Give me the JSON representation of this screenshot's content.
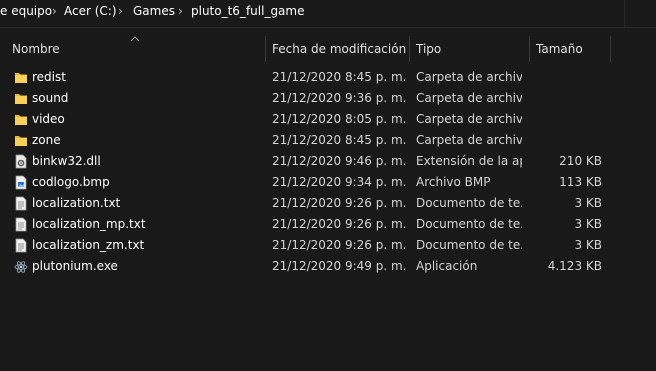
{
  "breadcrumb": {
    "items": [
      "e equipo",
      "Acer (C:)",
      "Games",
      "pluto_t6_full_game"
    ],
    "separator": "›"
  },
  "columns": {
    "name": "Nombre",
    "date": "Fecha de modificación",
    "type": "Tipo",
    "size": "Tamaño"
  },
  "files": [
    {
      "name": "redist",
      "date": "21/12/2020 8:45 p. m.",
      "type": "Carpeta de archivos",
      "size": "",
      "icon": "folder-icon"
    },
    {
      "name": "sound",
      "date": "21/12/2020 9:36 p. m.",
      "type": "Carpeta de archivos",
      "size": "",
      "icon": "folder-icon"
    },
    {
      "name": "video",
      "date": "21/12/2020 8:05 p. m.",
      "type": "Carpeta de archivos",
      "size": "",
      "icon": "folder-icon"
    },
    {
      "name": "zone",
      "date": "21/12/2020 8:45 p. m.",
      "type": "Carpeta de archivos",
      "size": "",
      "icon": "folder-icon"
    },
    {
      "name": "binkw32.dll",
      "date": "21/12/2020 9:46 p. m.",
      "type": "Extensión de la ap...",
      "size": "210 KB",
      "icon": "dll-icon"
    },
    {
      "name": "codlogo.bmp",
      "date": "21/12/2020 9:34 p. m.",
      "type": "Archivo BMP",
      "size": "113 KB",
      "icon": "bmp-icon"
    },
    {
      "name": "localization.txt",
      "date": "21/12/2020 9:26 p. m.",
      "type": "Documento de te...",
      "size": "3 KB",
      "icon": "txt-icon"
    },
    {
      "name": "localization_mp.txt",
      "date": "21/12/2020 9:26 p. m.",
      "type": "Documento de te...",
      "size": "3 KB",
      "icon": "txt-icon"
    },
    {
      "name": "localization_zm.txt",
      "date": "21/12/2020 9:26 p. m.",
      "type": "Documento de te...",
      "size": "3 KB",
      "icon": "txt-icon"
    },
    {
      "name": "plutonium.exe",
      "date": "21/12/2020 9:49 p. m.",
      "type": "Aplicación",
      "size": "4.123 KB",
      "icon": "exe-icon"
    }
  ],
  "colors": {
    "background": "#191919",
    "folder": "#f2c74c",
    "text": "#ffffff",
    "muted": "#d4d4d4"
  }
}
